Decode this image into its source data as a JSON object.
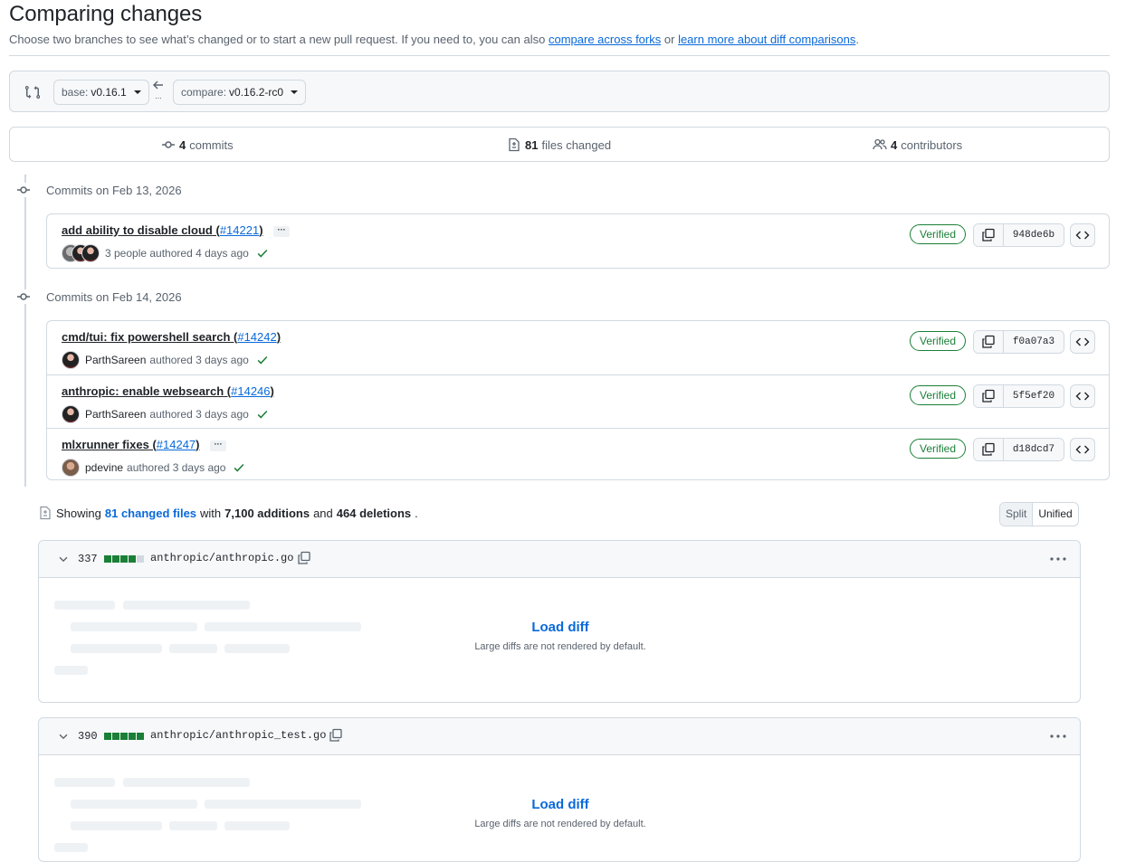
{
  "header": {
    "title": "Comparing changes",
    "subtitle_prefix": "Choose two branches to see what’s changed or to start a new pull request. If you need to, you can also",
    "link_forks": "compare across forks",
    "or": "or",
    "link_learn": "learn more about diff comparisons",
    "period": "."
  },
  "range": {
    "base_label": "base:",
    "base_value": "v0.16.1",
    "compare_label": "compare:",
    "compare_value": "v0.16.2-rc0",
    "arrow_dots": "..."
  },
  "summary": {
    "commits_count": "4",
    "commits_label": "commits",
    "files_count": "81",
    "files_label": "files changed",
    "contributors_count": "4",
    "contributors_label": "contributors"
  },
  "groups": [
    {
      "heading": "Commits on Feb 13, 2026",
      "commits": [
        {
          "message": "add ability to disable cloud",
          "open": " (",
          "pr": "#14221",
          "close": ")",
          "ellipsis": "···",
          "meta": "3 people authored 4 days ago",
          "verified": "Verified",
          "sha": "948de6b"
        }
      ]
    },
    {
      "heading": "Commits on Feb 14, 2026",
      "commits": [
        {
          "message": "cmd/tui: fix powershell search",
          "open": " (",
          "pr": "#14242",
          "close": ")",
          "user": "ParthSareen",
          "meta": "authored 3 days ago",
          "verified": "Verified",
          "sha": "f0a07a3"
        },
        {
          "message": "anthropic: enable websearch",
          "open": " (",
          "pr": "#14246",
          "close": ")",
          "user": "ParthSareen",
          "meta": "authored 3 days ago",
          "verified": "Verified",
          "sha": "5f5ef20"
        },
        {
          "message": "mlxrunner fixes",
          "open": " (",
          "pr": "#14247",
          "close": ")",
          "ellipsis": "···",
          "user": "pdevine",
          "meta": "authored 3 days ago",
          "verified": "Verified",
          "sha": "d18dcd7"
        }
      ]
    }
  ],
  "files_summary": {
    "showing": "Showing",
    "changed_files": "81 changed files",
    "with": "with",
    "additions": "7,100 additions",
    "and": "and",
    "deletions": "464 deletions",
    "period": "."
  },
  "view_toggle": {
    "split": "Split",
    "unified": "Unified",
    "selected": "Split"
  },
  "files": [
    {
      "count": "337",
      "diffstat_filled": 4,
      "path": "anthropic/anthropic.go",
      "load": "Load diff",
      "note": "Large diffs are not rendered by default."
    },
    {
      "count": "390",
      "diffstat_filled": 5,
      "path": "anthropic/anthropic_test.go",
      "load": "Load diff",
      "note": "Large diffs are not rendered by default."
    }
  ],
  "icons": {
    "compare": "git-compare-icon",
    "commit": "git-commit-icon",
    "file_diff": "file-diff-icon",
    "people": "people-icon",
    "copy": "copy-icon",
    "code": "code-icon",
    "check": "check-icon",
    "chevron": "chevron-down-icon",
    "kebab": "kebab-horizontal-icon"
  },
  "colors": {
    "link": "#0969da",
    "verified": "#1a7f37",
    "border": "#d1d9e0",
    "muted": "#59636e"
  }
}
